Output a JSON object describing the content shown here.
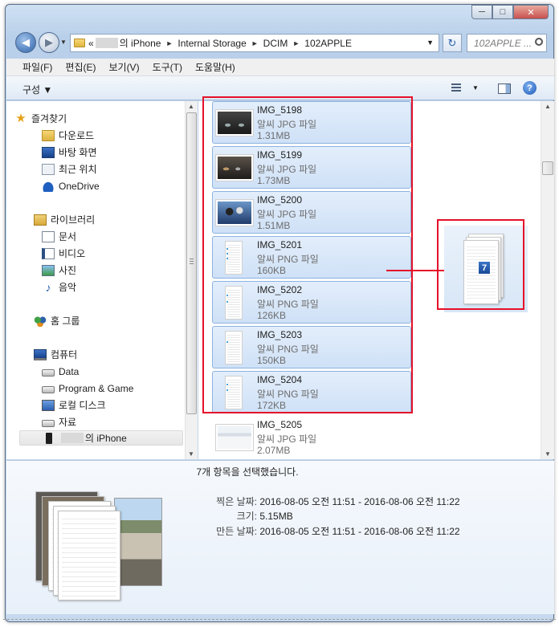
{
  "window": {
    "controls": {
      "minimize": "─",
      "maximize": "□",
      "close": "✕"
    }
  },
  "address": {
    "prefix": "«",
    "crumbs": [
      "의 iPhone",
      "Internal Storage",
      "DCIM",
      "102APPLE"
    ],
    "separator": "►",
    "search_placeholder": "102APPLE ..."
  },
  "menubar": {
    "items": [
      "파일(F)",
      "편집(E)",
      "보기(V)",
      "도구(T)",
      "도움말(H)"
    ]
  },
  "toolbar": {
    "organize_label": "구성 ▼",
    "help": "?"
  },
  "nav": {
    "favorites": "즐겨찾기",
    "downloads": "다운로드",
    "desktop": "바탕 화면",
    "recent": "최근 위치",
    "onedrive": "OneDrive",
    "libraries": "라이브러리",
    "documents": "문서",
    "videos": "비디오",
    "pictures": "사진",
    "music": "음악",
    "homegroup": "홈 그룹",
    "computer": "컴퓨터",
    "data_drive": "Data",
    "program_drive": "Program & Game",
    "local_disk": "로컬 디스크",
    "share": "자료",
    "iphone": "의 iPhone"
  },
  "files": [
    {
      "name": "IMG_5198",
      "type": "알씨 JPG 파일",
      "size": "1.31MB",
      "selected": true
    },
    {
      "name": "IMG_5199",
      "type": "알씨 JPG 파일",
      "size": "1.73MB",
      "selected": true
    },
    {
      "name": "IMG_5200",
      "type": "알씨 JPG 파일",
      "size": "1.51MB",
      "selected": true
    },
    {
      "name": "IMG_5201",
      "type": "알씨 PNG 파일",
      "size": "160KB",
      "selected": true
    },
    {
      "name": "IMG_5202",
      "type": "알씨 PNG 파일",
      "size": "126KB",
      "selected": true
    },
    {
      "name": "IMG_5203",
      "type": "알씨 PNG 파일",
      "size": "150KB",
      "selected": true
    },
    {
      "name": "IMG_5204",
      "type": "알씨 PNG 파일",
      "size": "172KB",
      "selected": true
    },
    {
      "name": "IMG_5205",
      "type": "알씨 JPG 파일",
      "size": "2.07MB",
      "selected": false
    }
  ],
  "drag": {
    "badge_count": "7"
  },
  "details": {
    "selection_text": "7개 항목을 선택했습니다.",
    "taken_label": "찍은 날짜:",
    "taken_value": "2016-08-05 오전 11:51 - 2016-08-06 오전 11:22",
    "size_label": "크기:",
    "size_value": "5.15MB",
    "created_label": "만든 날짜:",
    "created_value": "2016-08-05 오전 11:51 - 2016-08-06 오전 11:22"
  },
  "colors": {
    "annotation_red": "#e5102a",
    "selection_blue": "#cfe1f7"
  }
}
